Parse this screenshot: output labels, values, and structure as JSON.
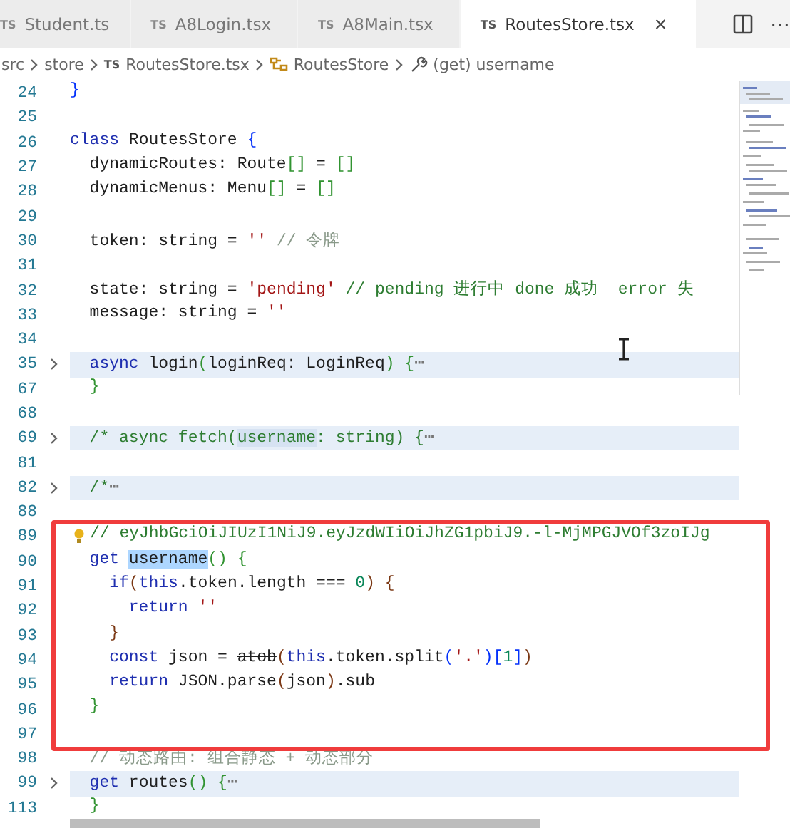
{
  "tabs": [
    {
      "badge": "TS",
      "label": "Student.ts",
      "selected": false,
      "closable": false
    },
    {
      "badge": "TS",
      "label": "A8Login.tsx",
      "selected": false,
      "closable": false
    },
    {
      "badge": "TS",
      "label": "A8Main.tsx",
      "selected": false,
      "closable": false
    },
    {
      "badge": "TS",
      "label": "RoutesStore.tsx",
      "selected": true,
      "closable": true,
      "close_label": "×"
    }
  ],
  "tab_actions": {
    "more_label": "⋯"
  },
  "breadcrumb": [
    {
      "kind": "folder",
      "label": "src"
    },
    {
      "kind": "folder",
      "label": "store"
    },
    {
      "kind": "file",
      "badge": "TS",
      "label": "RoutesStore.tsx"
    },
    {
      "kind": "class",
      "label": "RoutesStore"
    },
    {
      "kind": "property",
      "label": "(get) username"
    }
  ],
  "lines": [
    {
      "number": "24",
      "tokens": [
        {
          "t": "}",
          "color": "#0431fa"
        }
      ]
    },
    {
      "number": "25"
    },
    {
      "number": "26",
      "tokens": [
        {
          "t": "class ",
          "color": "#1f2fb0"
        },
        {
          "t": "RoutesStore ",
          "color": "#1f1f1f"
        },
        {
          "t": "{",
          "color": "#0431fa"
        }
      ]
    },
    {
      "number": "27",
      "tokens": [
        {
          "t": "  dynamicRoutes: Route",
          "color": "#1f1f1f"
        },
        {
          "t": "[]",
          "color": "#319331"
        },
        {
          "t": " = ",
          "color": "#1f1f1f"
        },
        {
          "t": "[]",
          "color": "#319331"
        }
      ]
    },
    {
      "number": "28",
      "tokens": [
        {
          "t": "  dynamicMenus: Menu",
          "color": "#1f1f1f"
        },
        {
          "t": "[]",
          "color": "#319331"
        },
        {
          "t": " = ",
          "color": "#1f1f1f"
        },
        {
          "t": "[]",
          "color": "#319331"
        }
      ]
    },
    {
      "number": "29"
    },
    {
      "number": "30",
      "tokens": [
        {
          "t": "  token: string = ",
          "color": "#1f1f1f"
        },
        {
          "t": "''",
          "color": "#a31515"
        },
        {
          "t": " // 令牌",
          "color": "#8a9a8a"
        }
      ]
    },
    {
      "number": "31"
    },
    {
      "number": "32",
      "tokens": [
        {
          "t": "  state: string = ",
          "color": "#1f1f1f"
        },
        {
          "t": "'pending'",
          "color": "#a31515"
        },
        {
          "t": " // pending 进行中 done 成功  error 失",
          "color": "#2e7d32"
        }
      ]
    },
    {
      "number": "33",
      "tokens": [
        {
          "t": "  message: string = ",
          "color": "#1f1f1f"
        },
        {
          "t": "''",
          "color": "#a31515"
        }
      ]
    },
    {
      "number": "34"
    },
    {
      "number": "35",
      "folded": true,
      "tokens": [
        {
          "t": "  async ",
          "color": "#1f2fb0"
        },
        {
          "t": "login",
          "color": "#1f1f1f"
        },
        {
          "t": "(",
          "color": "#319331"
        },
        {
          "t": "loginReq: LoginReq",
          "color": "#1f1f1f"
        },
        {
          "t": ")",
          "color": "#319331"
        },
        {
          "t": " {",
          "color": "#319331"
        },
        {
          "t": "⋯",
          "color": "#777777"
        }
      ]
    },
    {
      "number": "67",
      "tokens": [
        {
          "t": "  }",
          "color": "#319331"
        }
      ]
    },
    {
      "number": "68"
    },
    {
      "number": "69",
      "folded": true,
      "tokens": [
        {
          "t": "  /* async fetch(",
          "color": "#2e7d32"
        },
        {
          "t": "username",
          "color": "#2e7d32",
          "match": true
        },
        {
          "t": ": string) {",
          "color": "#2e7d32"
        },
        {
          "t": "⋯",
          "color": "#777777"
        }
      ]
    },
    {
      "number": "81"
    },
    {
      "number": "82",
      "folded": true,
      "tokens": [
        {
          "t": "  /*",
          "color": "#2e7d32"
        },
        {
          "t": "⋯",
          "color": "#777777"
        }
      ]
    },
    {
      "number": "88"
    },
    {
      "number": "89",
      "lightbulb": true,
      "boxed": true,
      "tokens": [
        {
          "t": "// eyJhbGciOiJIUzI1NiJ9.eyJzdWIiOiJhZG1pbiJ9.-l-MjMPGJVOf3zoIJg",
          "color": "#2e7d32"
        }
      ]
    },
    {
      "number": "90",
      "boxed": true,
      "tokens": [
        {
          "t": "  get ",
          "color": "#1f2fb0"
        },
        {
          "t": "username",
          "color": "#1f1f1f",
          "selected": true
        },
        {
          "t": "()",
          "color": "#319331"
        },
        {
          "t": " {",
          "color": "#319331"
        }
      ]
    },
    {
      "number": "91",
      "boxed": true,
      "tokens": [
        {
          "t": "    if",
          "color": "#1f2fb0"
        },
        {
          "t": "(",
          "color": "#7b3814"
        },
        {
          "t": "this",
          "color": "#1f2fb0"
        },
        {
          "t": ".token.length === ",
          "color": "#1f1f1f"
        },
        {
          "t": "0",
          "color": "#098658"
        },
        {
          "t": ")",
          "color": "#7b3814"
        },
        {
          "t": " {",
          "color": "#7b3814"
        }
      ]
    },
    {
      "number": "92",
      "boxed": true,
      "tokens": [
        {
          "t": "      return ",
          "color": "#1f2fb0"
        },
        {
          "t": "''",
          "color": "#a31515"
        }
      ]
    },
    {
      "number": "93",
      "boxed": true,
      "tokens": [
        {
          "t": "    }",
          "color": "#7b3814"
        }
      ]
    },
    {
      "number": "94",
      "boxed": true,
      "tokens": [
        {
          "t": "    const ",
          "color": "#1f2fb0"
        },
        {
          "t": "json = ",
          "color": "#1f1f1f"
        },
        {
          "t": "atob",
          "color": "#1f1f1f",
          "deprecated": true
        },
        {
          "t": "(",
          "color": "#7b3814"
        },
        {
          "t": "this",
          "color": "#1f2fb0"
        },
        {
          "t": ".token.split",
          "color": "#1f1f1f"
        },
        {
          "t": "(",
          "color": "#0431fa"
        },
        {
          "t": "'.'",
          "color": "#a31515"
        },
        {
          "t": ")[",
          "color": "#0431fa"
        },
        {
          "t": "1",
          "color": "#098658"
        },
        {
          "t": "]",
          "color": "#0431fa"
        },
        {
          "t": ")",
          "color": "#7b3814"
        }
      ]
    },
    {
      "number": "95",
      "boxed": true,
      "tokens": [
        {
          "t": "    return ",
          "color": "#1f2fb0"
        },
        {
          "t": "JSON.parse",
          "color": "#1f1f1f"
        },
        {
          "t": "(",
          "color": "#7b3814"
        },
        {
          "t": "json",
          "color": "#1f1f1f"
        },
        {
          "t": ")",
          "color": "#7b3814"
        },
        {
          "t": ".sub",
          "color": "#1f1f1f"
        }
      ]
    },
    {
      "number": "96",
      "boxed": true,
      "tokens": [
        {
          "t": "  }",
          "color": "#319331"
        }
      ]
    },
    {
      "number": "97",
      "boxed": true
    },
    {
      "number": "98",
      "tokens": [
        {
          "t": "  // 动态路由: 组合静态 + 动态部分",
          "color": "#8a9a8a"
        }
      ]
    },
    {
      "number": "99",
      "folded": true,
      "tokens": [
        {
          "t": "  get ",
          "color": "#1f2fb0"
        },
        {
          "t": "routes",
          "color": "#1f1f1f"
        },
        {
          "t": "()",
          "color": "#319331"
        },
        {
          "t": " {",
          "color": "#319331"
        },
        {
          "t": "⋯",
          "color": "#777777"
        }
      ]
    },
    {
      "number": "113",
      "tokens": [
        {
          "t": "  }",
          "color": "#319331"
        }
      ]
    }
  ],
  "highlight_frame": {
    "color": "#f03c3c"
  },
  "mouse_cursor": {
    "kind": "ibeam"
  }
}
